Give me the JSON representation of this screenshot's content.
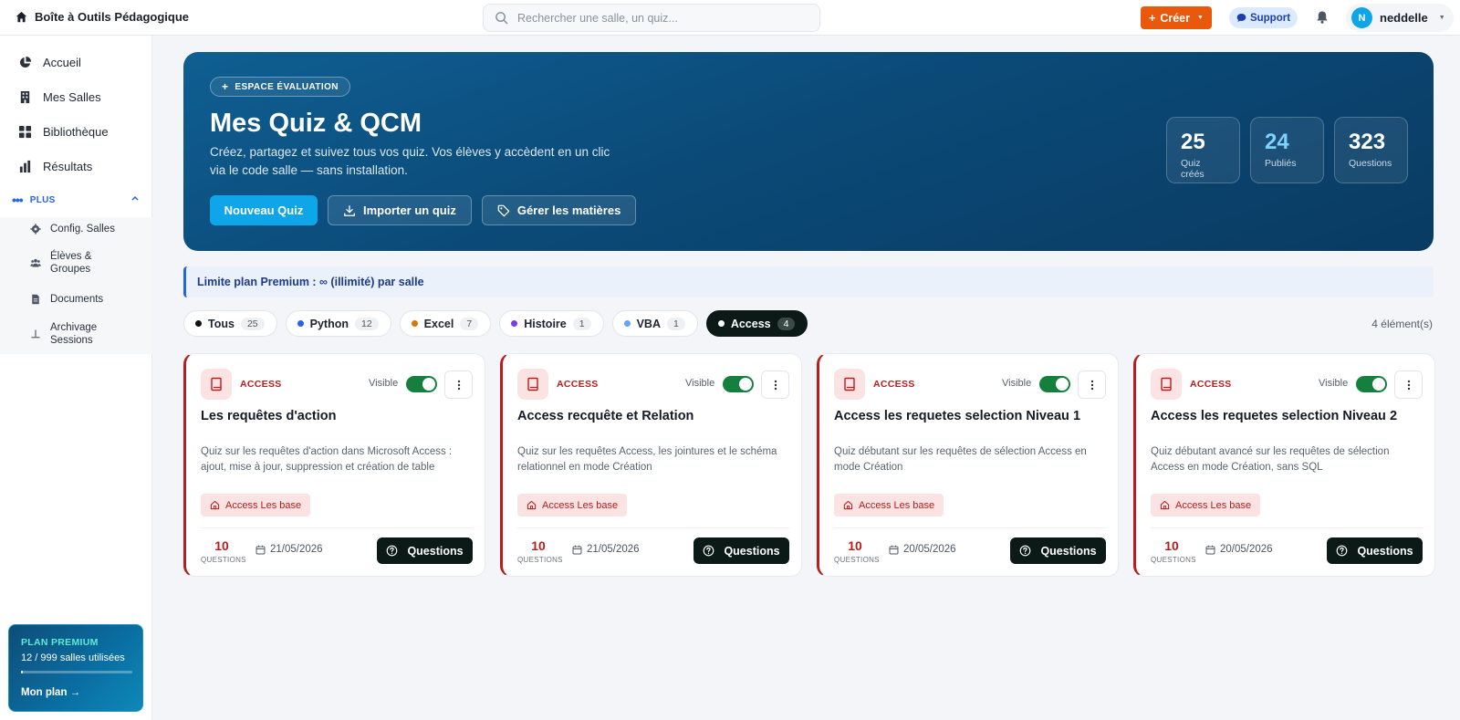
{
  "app": {
    "title": "Boîte à Outils Pédagogique"
  },
  "search": {
    "placeholder": "Rechercher une salle, un quiz..."
  },
  "header": {
    "create_label": "Créer",
    "support_label": "Support",
    "user_initial": "N",
    "user_name": "neddelle"
  },
  "sidebar": {
    "items": [
      {
        "label": "Accueil",
        "icon": "pie-chart-icon"
      },
      {
        "label": "Mes Salles",
        "icon": "building-icon"
      },
      {
        "label": "Bibliothèque",
        "icon": "grid-icon"
      },
      {
        "label": "Résultats",
        "icon": "bar-chart-icon"
      }
    ],
    "plus_label": "PLUS",
    "sub_items": [
      {
        "label": "Config. Salles",
        "icon": "gear-icon"
      },
      {
        "label": "Élèves & Groupes",
        "icon": "users-icon"
      },
      {
        "label": "Documents",
        "icon": "document-icon"
      },
      {
        "label": "Archivage Sessions",
        "icon": "archive-icon"
      }
    ],
    "premium": {
      "title": "PLAN PREMIUM",
      "usage": "12 / 999 salles utilisées",
      "usage_fraction": 0.012,
      "link": "Mon plan →"
    }
  },
  "hero": {
    "badge": "ESPACE ÉVALUATION",
    "title": "Mes Quiz & QCM",
    "description": "Créez, partagez et suivez tous vos quiz. Vos élèves y accèdent en un clic via le code salle — sans installation.",
    "buttons": {
      "new": "Nouveau Quiz",
      "import": "Importer un quiz",
      "subjects": "Gérer les matières"
    },
    "stats": [
      {
        "value": "25",
        "label": "Quiz créés"
      },
      {
        "value": "24",
        "label": "Publiés"
      },
      {
        "value": "323",
        "label": "Questions"
      }
    ]
  },
  "limit_banner": "Limite plan Premium : ∞ (illimité) par salle",
  "filters": [
    {
      "label": "Tous",
      "count": "25",
      "color": "#111111"
    },
    {
      "label": "Python",
      "count": "12",
      "color": "#2563eb"
    },
    {
      "label": "Excel",
      "count": "7",
      "color": "#d97706"
    },
    {
      "label": "Histoire",
      "count": "1",
      "color": "#7c3aed"
    },
    {
      "label": "VBA",
      "count": "1",
      "color": "#60a5fa"
    },
    {
      "label": "Access",
      "count": "4",
      "color": "#ffffff"
    }
  ],
  "active_filter": "Access",
  "result_count": "4 élément(s)",
  "colors": {
    "accent": "#0ea5e9",
    "create": "#ea580c",
    "access": "#b91c1c",
    "toggle_on": "#15803d"
  },
  "cards": [
    {
      "category": "ACCESS",
      "visible_label": "Visible",
      "title": "Les requêtes d'action",
      "description": "Quiz sur les requêtes d'action dans Microsoft Access : ajout, mise à jour, suppression et création de table",
      "tag": "Access Les base",
      "questions": "10",
      "questions_label": "QUESTIONS",
      "date": "21/05/2026",
      "button": "Questions"
    },
    {
      "category": "ACCESS",
      "visible_label": "Visible",
      "title": "Access recquête et Relation",
      "description": "Quiz sur les requêtes Access, les jointures et le schéma relationnel en mode Création",
      "tag": "Access Les base",
      "questions": "10",
      "questions_label": "QUESTIONS",
      "date": "21/05/2026",
      "button": "Questions"
    },
    {
      "category": "ACCESS",
      "visible_label": "Visible",
      "title": "Access les requetes selection Niveau 1",
      "description": "Quiz débutant sur les requêtes de sélection Access en mode Création",
      "tag": "Access Les base",
      "questions": "10",
      "questions_label": "QUESTIONS",
      "date": "20/05/2026",
      "button": "Questions"
    },
    {
      "category": "ACCESS",
      "visible_label": "Visible",
      "title": "Access les requetes selection Niveau 2",
      "description": "Quiz débutant avancé sur les requêtes de sélection Access en mode Création, sans SQL",
      "tag": "Access Les base",
      "questions": "10",
      "questions_label": "QUESTIONS",
      "date": "20/05/2026",
      "button": "Questions"
    }
  ]
}
